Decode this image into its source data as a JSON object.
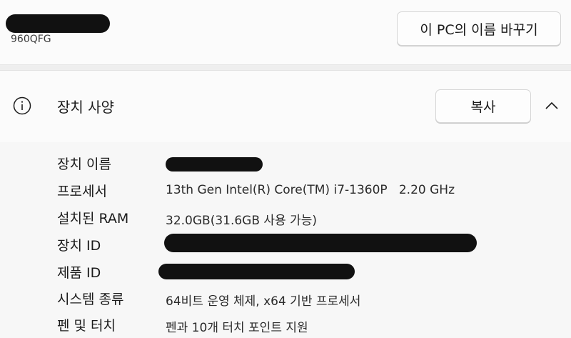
{
  "device": {
    "name_suffix": "960QFG",
    "rename_label": "이 PC의 이름 바꾸기"
  },
  "specs": {
    "title": "장치 사양",
    "copy_label": "복사",
    "rows": [
      {
        "label": "장치 이름",
        "value": ""
      },
      {
        "label": "프로세서",
        "value": "13th Gen Intel(R) Core(TM) i7-1360P   2.20 GHz"
      },
      {
        "label": "설치된 RAM",
        "value": "32.0GB(31.6GB 사용 가능)"
      },
      {
        "label": "장치 ID",
        "value": ""
      },
      {
        "label": "제품 ID",
        "value": ""
      },
      {
        "label": "시스템 종류",
        "value": "64비트 운영 체제, x64 기반 프로세서"
      },
      {
        "label": "펜 및 터치",
        "value": "펜과 10개 터치 포인트 지원"
      }
    ]
  },
  "icons": {
    "info": "info-icon",
    "chevron": "chevron-up-icon"
  }
}
